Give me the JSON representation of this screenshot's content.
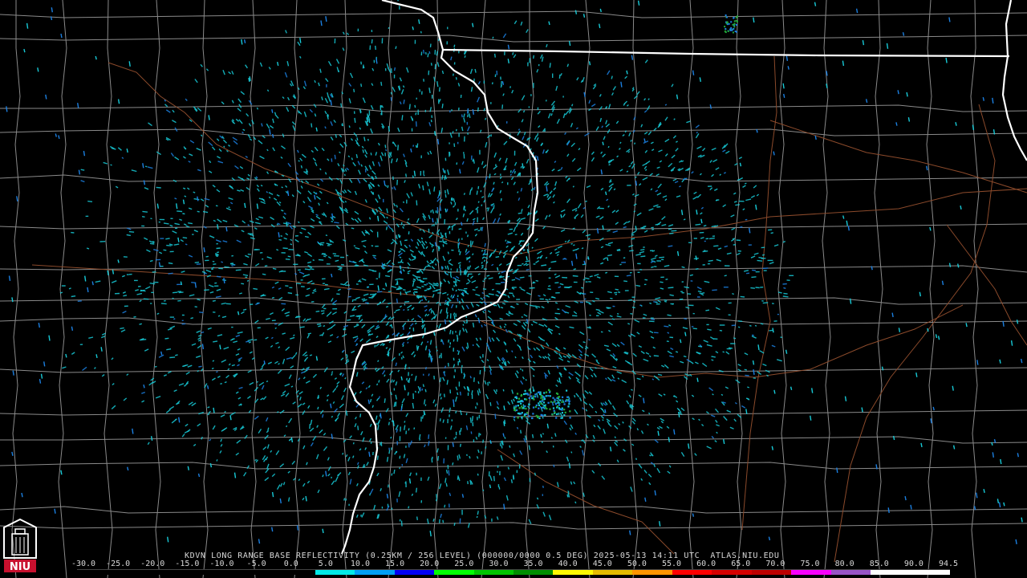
{
  "caption": "KDVN LONG RANGE BASE REFLECTIVITY (0.25KM / 256 LEVEL) (000000/0000 0.5 DEG) 2025-05-13 14:11 UTC  ATLAS.NIU.EDU",
  "logo": {
    "icon": "niu-castle-logo",
    "text": "NIU",
    "color": "#c8102e"
  },
  "legend": {
    "ticks": [
      "-30.0",
      "-25.0",
      "-20.0",
      "-15.0",
      "-10.0",
      "-5.0",
      "0.0",
      "5.0",
      "10.0",
      "15.0",
      "20.0",
      "25.0",
      "30.0",
      "35.0",
      "40.0",
      "45.0",
      "50.0",
      "55.0",
      "60.0",
      "65.0",
      "70.0",
      "75.0",
      "80.0",
      "85.0",
      "90.0",
      "94.5"
    ],
    "colors": [
      "#000000",
      "#000000",
      "#000000",
      "#000000",
      "#000000",
      "#000000",
      "#04e9e7",
      "#019ff4",
      "#0300f4",
      "#02fd02",
      "#01c501",
      "#008e00",
      "#fdf802",
      "#e5bc00",
      "#fd9500",
      "#fd0000",
      "#d40000",
      "#bc0000",
      "#f800fd",
      "#9854c6",
      "#fdfdfd",
      "#fdfdfd"
    ]
  },
  "map_colors": {
    "state_border": "#ffffff",
    "county_lines": "#8a8a8a",
    "highways": "#8b4a2b",
    "echo_light": "#17c9d6",
    "echo_mid": "#1b7fe0",
    "echo_green": "#22a83a"
  }
}
